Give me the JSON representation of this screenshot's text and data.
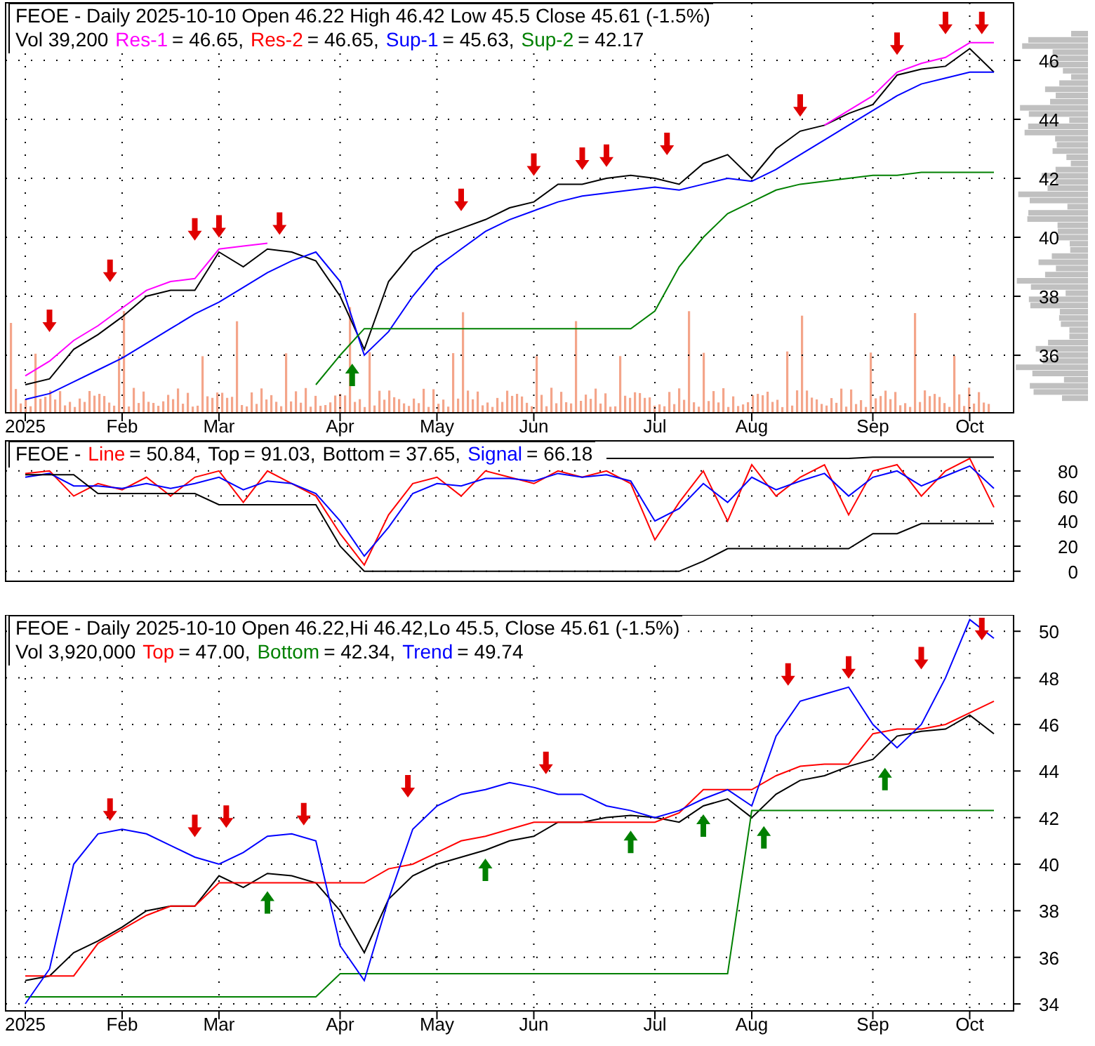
{
  "panels": [
    {
      "kind": "price",
      "header": {
        "title": "FEOE - Daily 2025-10-10 Open 46.22  High 46.42  Low 45.5  Close 45.61 (-1.5%)",
        "prefix": "Vol 39,200",
        "legend": [
          {
            "label": "Res-1",
            "value": "= 46.65,",
            "color": "#ff00ff"
          },
          {
            "label": "Res-2",
            "value": "= 46.65,",
            "color": "#ff0000"
          },
          {
            "label": "Sup-1",
            "value": "= 45.63,",
            "color": "#0000ff"
          },
          {
            "label": "Sup-2",
            "value": "= 42.17",
            "color": "#008000"
          }
        ]
      },
      "chart_data": {
        "type": "line",
        "grid": true,
        "categories": [
          "2025",
          null,
          null,
          null,
          "Feb",
          null,
          null,
          null,
          "Mar",
          null,
          null,
          null,
          null,
          "Apr",
          null,
          null,
          null,
          "May",
          null,
          null,
          null,
          "Jun",
          null,
          null,
          null,
          null,
          "Jul",
          null,
          null,
          null,
          "Aug",
          null,
          null,
          null,
          null,
          "Sep",
          null,
          null,
          null,
          "Oct",
          null
        ],
        "ylim": [
          34.05,
          47.95
        ],
        "yticks": [
          36,
          38,
          40,
          42,
          44,
          46
        ],
        "series": [
          {
            "color": "#000000",
            "values": [
              35.0,
              35.2,
              36.2,
              36.7,
              37.3,
              38.0,
              38.2,
              38.2,
              39.5,
              39.0,
              39.6,
              39.5,
              39.2,
              38.0,
              36.2,
              38.5,
              39.5,
              40.0,
              40.3,
              40.6,
              41.0,
              41.2,
              41.8,
              41.8,
              42.0,
              42.1,
              42.0,
              41.8,
              42.5,
              42.8,
              42.0,
              43.0,
              43.6,
              43.8,
              44.2,
              44.5,
              45.5,
              45.7,
              45.8,
              46.4,
              45.6
            ]
          },
          {
            "color": "#ff00ff",
            "values": [
              35.3,
              35.8,
              36.5,
              37.0,
              37.6,
              38.2,
              38.5,
              38.6,
              39.6,
              39.7,
              39.8,
              null,
              null,
              null,
              null,
              null,
              null,
              null,
              null,
              null,
              null,
              null,
              null,
              null,
              null,
              null,
              null,
              null,
              null,
              null,
              null,
              null,
              null,
              43.8,
              44.3,
              44.8,
              45.6,
              45.9,
              46.1,
              46.6,
              46.6
            ]
          },
          {
            "color": "#0000ff",
            "values": [
              34.5,
              34.7,
              35.1,
              35.5,
              35.9,
              36.4,
              36.9,
              37.4,
              37.8,
              38.3,
              38.8,
              39.2,
              39.5,
              38.5,
              36.0,
              36.8,
              38.0,
              39.0,
              39.6,
              40.2,
              40.6,
              40.9,
              41.2,
              41.4,
              41.5,
              41.6,
              41.7,
              41.6,
              41.8,
              42.0,
              41.9,
              42.3,
              42.8,
              43.3,
              43.8,
              44.3,
              44.8,
              45.2,
              45.4,
              45.6,
              45.6
            ]
          },
          {
            "color": "#008000",
            "values": [
              null,
              null,
              null,
              null,
              null,
              null,
              null,
              null,
              null,
              null,
              null,
              null,
              35.0,
              36.0,
              36.9,
              36.9,
              36.9,
              36.9,
              36.9,
              36.9,
              36.9,
              36.9,
              36.9,
              36.9,
              36.9,
              36.9,
              37.5,
              39.0,
              40.0,
              40.8,
              41.2,
              41.6,
              41.8,
              41.9,
              42.0,
              42.1,
              42.1,
              42.2,
              42.2,
              42.2,
              42.2
            ]
          }
        ]
      }
    },
    {
      "kind": "oscillator",
      "header": {
        "prefix": "FEOE -",
        "legend": [
          {
            "label": "Line",
            "value": "= 50.84,",
            "color": "#ff0000"
          },
          {
            "label": "Top",
            "value": "= 91.03,",
            "color": "#000000"
          },
          {
            "label": "Bottom",
            "value": "= 37.65,",
            "color": "#000000"
          },
          {
            "label": "Signal",
            "value": "= 66.18",
            "color": "#0000ff"
          }
        ]
      },
      "chart_data": {
        "type": "line",
        "grid": true,
        "categories": [
          null,
          null,
          null,
          null,
          null,
          null,
          null,
          null,
          null,
          null,
          null,
          null,
          null,
          null,
          null,
          null,
          null,
          null,
          null,
          null,
          null,
          null,
          null,
          null,
          null,
          null,
          null,
          null,
          null,
          null,
          null,
          null,
          null,
          null,
          null,
          null,
          null,
          null,
          null,
          null,
          null
        ],
        "ylim": [
          -8,
          104
        ],
        "yticks": [
          0,
          20,
          40,
          60,
          80
        ],
        "series": [
          {
            "color": "#ff0000",
            "values": [
              78,
              80,
              60,
              70,
              65,
              75,
              60,
              75,
              80,
              55,
              80,
              70,
              60,
              30,
              5,
              45,
              70,
              75,
              60,
              80,
              75,
              70,
              80,
              75,
              80,
              70,
              25,
              55,
              80,
              40,
              85,
              60,
              75,
              85,
              45,
              80,
              85,
              60,
              80,
              90,
              51
            ]
          },
          {
            "color": "#0000ff",
            "values": [
              75,
              78,
              68,
              68,
              66,
              70,
              66,
              70,
              75,
              65,
              72,
              70,
              62,
              40,
              12,
              35,
              62,
              70,
              68,
              74,
              74,
              72,
              78,
              75,
              77,
              72,
              40,
              50,
              70,
              55,
              75,
              65,
              72,
              78,
              60,
              75,
              80,
              68,
              76,
              84,
              66
            ]
          },
          {
            "color": "#000000",
            "values": [
              null,
              null,
              null,
              null,
              null,
              null,
              null,
              null,
              null,
              null,
              null,
              null,
              null,
              null,
              null,
              null,
              null,
              null,
              null,
              null,
              null,
              null,
              null,
              null,
              90,
              90,
              90,
              90,
              90,
              90,
              90,
              90,
              90,
              90,
              90,
              91,
              91,
              91,
              91,
              91,
              91
            ]
          },
          {
            "color": "#000000",
            "values": [
              77,
              77,
              77,
              62,
              62,
              62,
              62,
              62,
              53,
              53,
              53,
              53,
              53,
              20,
              0,
              0,
              0,
              0,
              0,
              0,
              0,
              0,
              0,
              0,
              0,
              0,
              0,
              0,
              8,
              18,
              18,
              18,
              18,
              18,
              18,
              30,
              30,
              38,
              38,
              38,
              38
            ]
          }
        ]
      }
    },
    {
      "kind": "price",
      "header": {
        "title": "FEOE - Daily 2025-10-10 Open 46.22,Hi 46.42,Lo 45.5, Close 45.61 (-1.5%)",
        "prefix": "Vol 3,920,000",
        "legend": [
          {
            "label": "Top",
            "value": "= 47.00,",
            "color": "#ff0000"
          },
          {
            "label": "Bottom",
            "value": "= 42.34,",
            "color": "#008000"
          },
          {
            "label": "Trend",
            "value": "= 49.74",
            "color": "#0000ff"
          }
        ]
      },
      "chart_data": {
        "type": "line",
        "grid": true,
        "categories": [
          "2025",
          null,
          null,
          null,
          "Feb",
          null,
          null,
          null,
          "Mar",
          null,
          null,
          null,
          null,
          "Apr",
          null,
          null,
          null,
          "May",
          null,
          null,
          null,
          "Jun",
          null,
          null,
          null,
          null,
          "Jul",
          null,
          null,
          null,
          "Aug",
          null,
          null,
          null,
          null,
          "Sep",
          null,
          null,
          null,
          "Oct",
          null
        ],
        "ylim": [
          33.7,
          50.7
        ],
        "yticks": [
          34,
          36,
          38,
          40,
          42,
          44,
          46,
          48,
          50
        ],
        "series": [
          {
            "color": "#000000",
            "values": [
              35.0,
              35.2,
              36.2,
              36.7,
              37.3,
              38.0,
              38.2,
              38.2,
              39.5,
              39.0,
              39.6,
              39.5,
              39.2,
              38.0,
              36.2,
              38.5,
              39.5,
              40.0,
              40.3,
              40.6,
              41.0,
              41.2,
              41.8,
              41.8,
              42.0,
              42.1,
              42.0,
              41.8,
              42.5,
              42.8,
              42.0,
              43.0,
              43.6,
              43.8,
              44.2,
              44.5,
              45.5,
              45.7,
              45.8,
              46.4,
              45.6
            ]
          },
          {
            "color": "#ff0000",
            "values": [
              35.2,
              35.2,
              35.2,
              36.6,
              37.2,
              37.8,
              38.2,
              38.2,
              39.2,
              39.2,
              39.2,
              39.2,
              39.2,
              39.2,
              39.2,
              39.8,
              40.0,
              40.5,
              41.0,
              41.2,
              41.5,
              41.8,
              41.8,
              41.8,
              41.8,
              41.8,
              41.8,
              42.2,
              43.2,
              43.2,
              43.2,
              43.8,
              44.2,
              44.3,
              44.3,
              45.6,
              45.8,
              45.8,
              46.0,
              46.5,
              47.0
            ]
          },
          {
            "color": "#008000",
            "values": [
              34.3,
              34.3,
              34.3,
              34.3,
              34.3,
              34.3,
              34.3,
              34.3,
              34.3,
              34.3,
              34.3,
              34.3,
              34.3,
              35.3,
              35.3,
              35.3,
              35.3,
              35.3,
              35.3,
              35.3,
              35.3,
              35.3,
              35.3,
              35.3,
              35.3,
              35.3,
              35.3,
              35.3,
              35.3,
              35.3,
              42.3,
              42.3,
              42.3,
              42.3,
              42.3,
              42.3,
              42.3,
              42.3,
              42.3,
              42.3,
              42.3
            ]
          },
          {
            "color": "#0000ff",
            "values": [
              34.0,
              35.5,
              40.0,
              41.3,
              41.5,
              41.3,
              40.8,
              40.3,
              40.0,
              40.5,
              41.2,
              41.3,
              41.0,
              36.5,
              35.0,
              38.5,
              41.5,
              42.5,
              43.0,
              43.2,
              43.5,
              43.3,
              43.0,
              43.0,
              42.5,
              42.3,
              42.0,
              42.3,
              42.8,
              43.2,
              42.5,
              45.5,
              47.0,
              47.3,
              47.6,
              46.0,
              45.0,
              46.0,
              48.0,
              50.5,
              49.7
            ]
          }
        ]
      }
    }
  ]
}
